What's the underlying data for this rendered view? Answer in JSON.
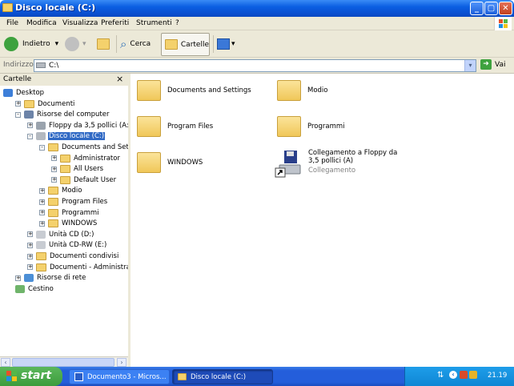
{
  "window": {
    "title": "Disco locale (C:)"
  },
  "menu": [
    "File",
    "Modifica",
    "Visualizza",
    "Preferiti",
    "Strumenti",
    "?"
  ],
  "toolbar": {
    "back": "Indietro",
    "search": "Cerca",
    "folders": "Cartelle"
  },
  "address": {
    "label": "Indirizzo",
    "value": "C:\\",
    "go": "Vai"
  },
  "pane": {
    "title": "Cartelle",
    "close": "×"
  },
  "tree": [
    {
      "label": "Desktop",
      "level": 0,
      "pm": "",
      "icon": "desktop-icon"
    },
    {
      "label": "Documenti",
      "level": 1,
      "pm": "+",
      "icon": "documents-folder-icon"
    },
    {
      "label": "Risorse del computer",
      "level": 1,
      "pm": "-",
      "icon": "my-computer-icon"
    },
    {
      "label": "Floppy da 3,5 pollici (A:)",
      "level": 2,
      "pm": "+",
      "icon": "floppy-drive-icon"
    },
    {
      "label": "Disco locale (C:)",
      "level": 2,
      "pm": "-",
      "icon": "hard-disk-icon",
      "selected": true
    },
    {
      "label": "Documents and Settings",
      "level": 3,
      "pm": "-",
      "icon": "folder-icon"
    },
    {
      "label": "Administrator",
      "level": 4,
      "pm": "+",
      "icon": "folder-icon"
    },
    {
      "label": "All Users",
      "level": 4,
      "pm": "+",
      "icon": "folder-icon"
    },
    {
      "label": "Default User",
      "level": 4,
      "pm": "+",
      "icon": "folder-icon"
    },
    {
      "label": "Modio",
      "level": 3,
      "pm": "+",
      "icon": "folder-icon"
    },
    {
      "label": "Program Files",
      "level": 3,
      "pm": "+",
      "icon": "folder-icon"
    },
    {
      "label": "Programmi",
      "level": 3,
      "pm": "+",
      "icon": "folder-icon"
    },
    {
      "label": "WINDOWS",
      "level": 3,
      "pm": "+",
      "icon": "folder-icon"
    },
    {
      "label": "Unità CD (D:)",
      "level": 2,
      "pm": "+",
      "icon": "cd-drive-icon"
    },
    {
      "label": "Unità CD-RW (E:)",
      "level": 2,
      "pm": "+",
      "icon": "cd-drive-icon"
    },
    {
      "label": "Documenti condivisi",
      "level": 2,
      "pm": "+",
      "icon": "folder-icon"
    },
    {
      "label": "Documenti - Administrator",
      "level": 2,
      "pm": "+",
      "icon": "folder-icon"
    },
    {
      "label": "Risorse di rete",
      "level": 1,
      "pm": "+",
      "icon": "network-icon"
    },
    {
      "label": "Cestino",
      "level": 1,
      "pm": "",
      "icon": "recycle-bin-icon"
    }
  ],
  "items": [
    {
      "name": "Documents and Settings"
    },
    {
      "name": "Modio"
    },
    {
      "name": "Program Files"
    },
    {
      "name": "Programmi"
    },
    {
      "name": "WINDOWS"
    },
    {
      "name": "Collegamento a Floppy da 3,5 pollici (A)",
      "type": "Collegamento"
    }
  ],
  "taskbar": {
    "start": "start",
    "tasks": [
      "Documento3 - Micros...",
      "Disco locale (C:)"
    ],
    "lang": "IT",
    "clock": "21.19"
  },
  "colors": {
    "titlebar": "#0b5fe2",
    "taskbar": "#245edb",
    "start": "#3c9c3c",
    "selection": "#316ac5"
  }
}
